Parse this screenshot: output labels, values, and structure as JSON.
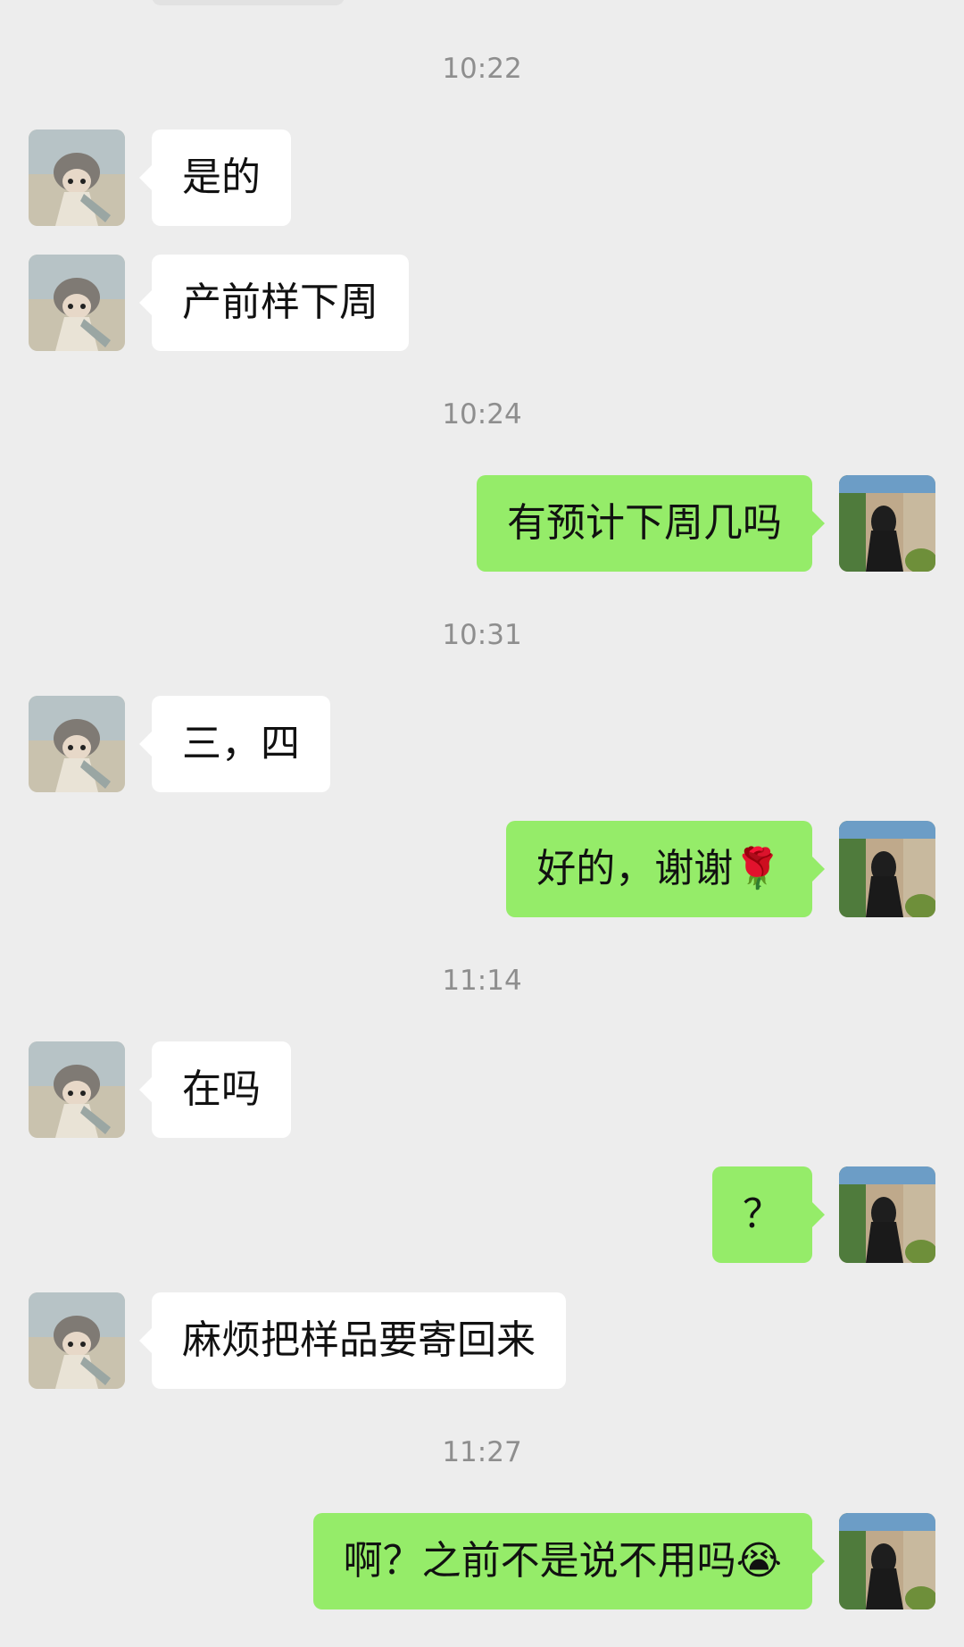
{
  "messages": [
    {
      "type": "time",
      "text": "10:22"
    },
    {
      "type": "msg",
      "side": "in",
      "text": "是的"
    },
    {
      "type": "msg",
      "side": "in",
      "text": "产前样下周"
    },
    {
      "type": "time",
      "text": "10:24"
    },
    {
      "type": "msg",
      "side": "out",
      "text": "有预计下周几吗"
    },
    {
      "type": "time",
      "text": "10:31"
    },
    {
      "type": "msg",
      "side": "in",
      "text": "三，四"
    },
    {
      "type": "msg",
      "side": "out",
      "text": "好的，谢谢🌹"
    },
    {
      "type": "time",
      "text": "11:14"
    },
    {
      "type": "msg",
      "side": "in",
      "text": "在吗"
    },
    {
      "type": "msg",
      "side": "out",
      "text": "？"
    },
    {
      "type": "msg",
      "side": "in",
      "text": "麻烦把样品要寄回来"
    },
    {
      "type": "time",
      "text": "11:27"
    },
    {
      "type": "msg",
      "side": "out",
      "text": "啊？之前不是说不用吗😭"
    }
  ],
  "colors": {
    "background": "#ededed",
    "incoming_bubble": "#ffffff",
    "outgoing_bubble": "#95ec69",
    "timestamp": "#8e8e8e"
  },
  "icons": {
    "incoming_avatar": "contact-avatar-photo",
    "outgoing_avatar": "self-avatar-photo"
  }
}
